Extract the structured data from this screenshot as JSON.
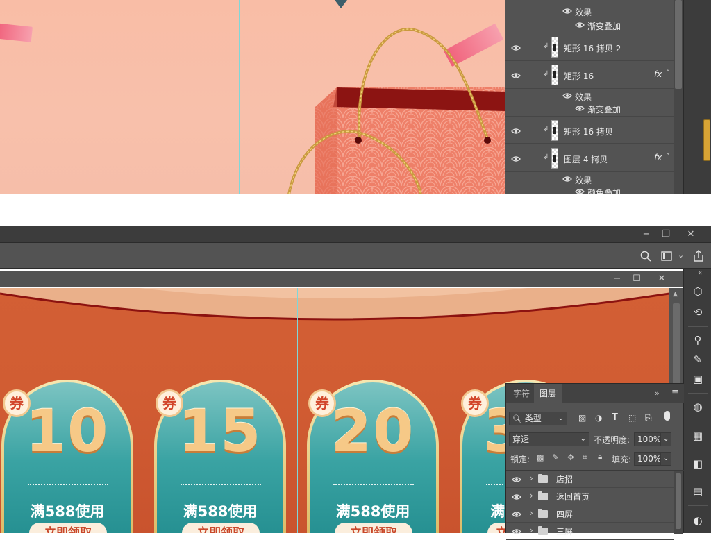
{
  "top_panel": {
    "layers": [
      {
        "name": "矩形 16 拷贝 2",
        "fx": false,
        "effects": []
      },
      {
        "name": "矩形 16",
        "fx": true,
        "effects_label": "效果",
        "effects": [
          "渐变叠加"
        ]
      },
      {
        "name": "矩形 16 拷贝",
        "fx": false,
        "effects": []
      },
      {
        "name": "图层 4 拷贝",
        "fx": true,
        "effects_label": "效果",
        "effects": [
          "颜色叠加"
        ]
      }
    ],
    "head_effects_label": "效果",
    "head_effect": "渐变叠加",
    "fx_glyph": "fx"
  },
  "canvas": {
    "coupons": [
      {
        "badge": "券",
        "value": "10",
        "condition": "满588使用",
        "button": "立即领取"
      },
      {
        "badge": "券",
        "value": "15",
        "condition": "满588使用",
        "button": "立即领取"
      },
      {
        "badge": "券",
        "value": "20",
        "condition": "满588使用",
        "button": "立即领取"
      },
      {
        "badge": "券",
        "value": "3",
        "condition": "满",
        "button": "立即"
      }
    ]
  },
  "layers_panel": {
    "tabs": [
      "字符",
      "图层"
    ],
    "active_tab": "图层",
    "filter_kind": "类型",
    "blend_mode": "穿透",
    "opacity_label": "不透明度:",
    "opacity_value": "100%",
    "lock_label": "锁定:",
    "fill_label": "填充:",
    "fill_value": "100%",
    "groups": [
      "店招",
      "返回首页",
      "四屏",
      "三屏"
    ]
  },
  "colors": {
    "ps_panel": "#535353",
    "ps_dark": "#3c3c3c",
    "canvas_orange": "#d35f34",
    "coupon_teal": "#3aa3a3",
    "coupon_number": "#f6c987"
  }
}
